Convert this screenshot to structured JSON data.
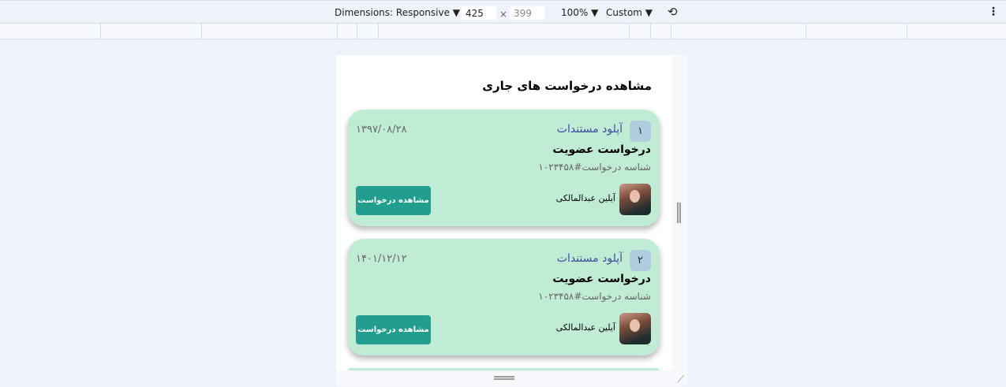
{
  "devtools": {
    "dimensions_label": "Dimensions: Responsive",
    "width": "425",
    "height": "399",
    "zoom": "100%",
    "throttle": "Custom",
    "times": "×",
    "rotate_icon": "rotate-icon",
    "more_icon": "more-vertical-icon"
  },
  "page": {
    "title": "مشاهده درخواست های جاری"
  },
  "cards": [
    {
      "number": "۱",
      "stage": "آپلود مستندات",
      "date": "۱۳۹۷/۰۸/۲۸",
      "title": "درخواست عضویت",
      "request_id": "شناسه درخواست#۱۰۲۳۴۵۸",
      "user": "آیلین عبدالمالکی",
      "button": "مشاهده درخواست"
    },
    {
      "number": "۲",
      "stage": "آپلود مستندات",
      "date": "۱۴۰۱/۱۲/۱۲",
      "title": "درخواست عضویت",
      "request_id": "شناسه درخواست#۱۰۲۳۴۵۸",
      "user": "آیلین عبدالمالکی",
      "button": "مشاهده درخواست"
    }
  ],
  "colors": {
    "card": "#c0ecd5",
    "button": "#229e8f",
    "badge": "#b0cde0",
    "stage": "#3b4f9a"
  }
}
